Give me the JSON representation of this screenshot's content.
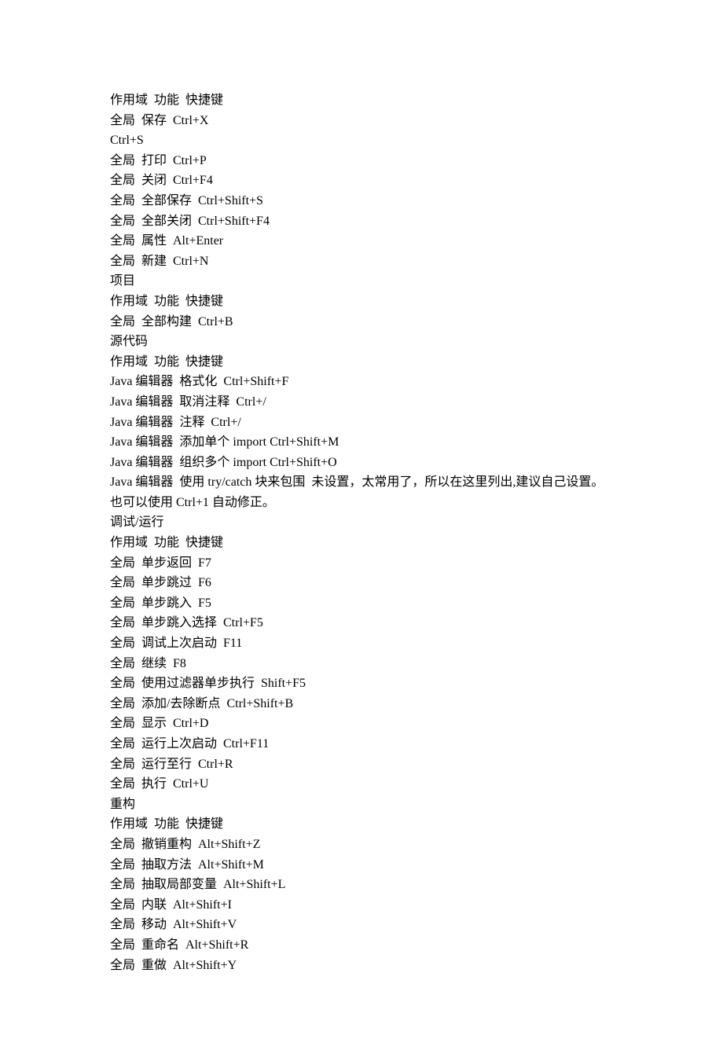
{
  "lines": [
    "作用域  功能  快捷键",
    "全局  保存  Ctrl+X",
    "Ctrl+S",
    "全局  打印  Ctrl+P",
    "全局  关闭  Ctrl+F4",
    "全局  全部保存  Ctrl+Shift+S",
    "全局  全部关闭  Ctrl+Shift+F4",
    "全局  属性  Alt+Enter",
    "全局  新建  Ctrl+N",
    "项目",
    "作用域  功能  快捷键",
    "全局  全部构建  Ctrl+B",
    "源代码",
    "作用域  功能  快捷键",
    "Java 编辑器  格式化  Ctrl+Shift+F",
    "Java 编辑器  取消注释  Ctrl+/",
    "Java 编辑器  注释  Ctrl+/",
    "Java 编辑器  添加单个 import Ctrl+Shift+M",
    "Java 编辑器  组织多个 import Ctrl+Shift+O",
    "Java 编辑器  使用 try/catch 块来包围  未设置，太常用了，所以在这里列出,建议自己设置。",
    "也可以使用 Ctrl+1 自动修正。",
    "调试/运行",
    "作用域  功能  快捷键",
    "全局  单步返回  F7",
    "全局  单步跳过  F6",
    "全局  单步跳入  F5",
    "全局  单步跳入选择  Ctrl+F5",
    "全局  调试上次启动  F11",
    "全局  继续  F8",
    "全局  使用过滤器单步执行  Shift+F5",
    "全局  添加/去除断点  Ctrl+Shift+B",
    "全局  显示  Ctrl+D",
    "全局  运行上次启动  Ctrl+F11",
    "全局  运行至行  Ctrl+R",
    "全局  执行  Ctrl+U",
    "重构",
    "作用域  功能  快捷键",
    "全局  撤销重构  Alt+Shift+Z",
    "全局  抽取方法  Alt+Shift+M",
    "全局  抽取局部变量  Alt+Shift+L",
    "全局  内联  Alt+Shift+I",
    "全局  移动  Alt+Shift+V",
    "全局  重命名  Alt+Shift+R",
    "全局  重做  Alt+Shift+Y"
  ]
}
